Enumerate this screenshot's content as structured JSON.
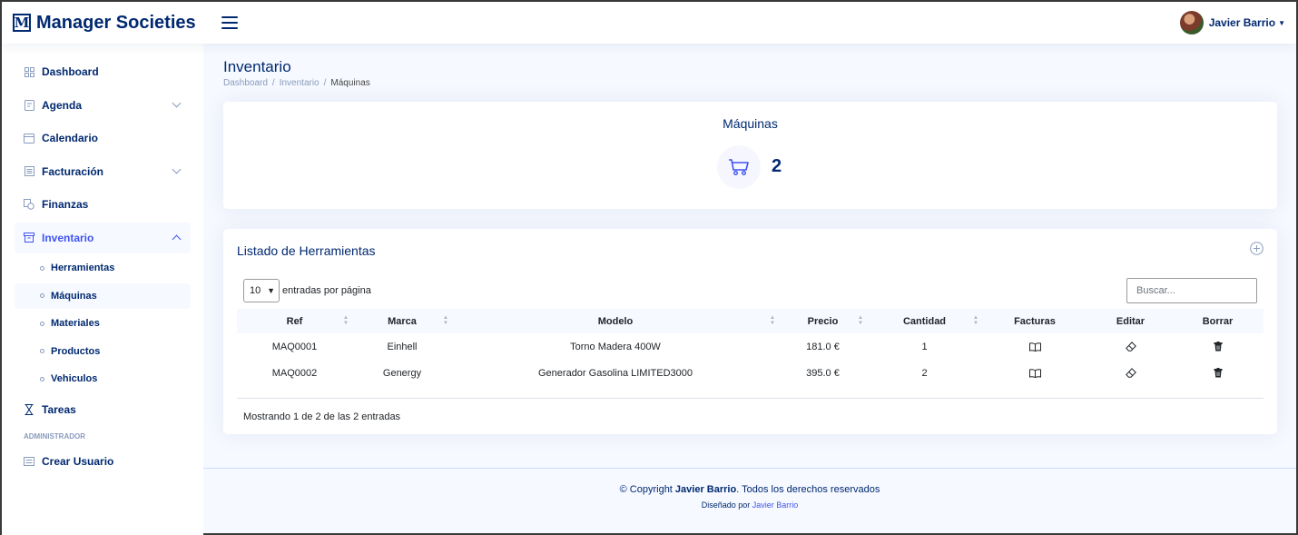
{
  "header": {
    "logo_letter": "M",
    "app_title": "Manager Societies",
    "user_name": "Javier Barrio"
  },
  "sidebar": {
    "items": [
      {
        "label": "Dashboard",
        "icon": "grid-icon"
      },
      {
        "label": "Agenda",
        "icon": "journal-icon"
      },
      {
        "label": "Calendario",
        "icon": "calendar-icon"
      },
      {
        "label": "Facturación",
        "icon": "invoice-icon"
      },
      {
        "label": "Finanzas",
        "icon": "cash-icon"
      },
      {
        "label": "Inventario",
        "icon": "archive-icon"
      }
    ],
    "sub_items": [
      "Herramientas",
      "Máquinas",
      "Materiales",
      "Productos",
      "Vehiculos"
    ],
    "tareas": "Tareas",
    "admin_heading": "ADMINISTRADOR",
    "crear_usuario": "Crear Usuario"
  },
  "page": {
    "title": "Inventario",
    "breadcrumb": [
      "Dashboard",
      "Inventario",
      "Máquinas"
    ]
  },
  "summary": {
    "title": "Máquinas",
    "value": "2",
    "icon": "cart-icon"
  },
  "list": {
    "title": "Listado de Herramientas",
    "per_page_value": "10",
    "per_page_label": "entradas por página",
    "search_placeholder": "Buscar...",
    "columns": [
      "Ref",
      "Marca",
      "Modelo",
      "Precio",
      "Cantidad",
      "Facturas",
      "Editar",
      "Borrar"
    ],
    "rows": [
      {
        "ref": "MAQ0001",
        "marca": "Einhell",
        "modelo": "Torno Madera 400W",
        "precio": "181.0 €",
        "cantidad": "1"
      },
      {
        "ref": "MAQ0002",
        "marca": "Genergy",
        "modelo": "Generador Gasolina LIMITED3000",
        "precio": "395.0 €",
        "cantidad": "2"
      }
    ],
    "info": "Mostrando 1 de 2 de las 2 entradas"
  },
  "footer": {
    "copy_prefix": "© Copyright ",
    "copy_name": "Javier Barrio",
    "copy_suffix": ". Todos los derechos reservados",
    "designed_by": "Diseñado por ",
    "designer": "Javier Barrio"
  },
  "colors": {
    "brand": "#012970",
    "accent": "#4154f1",
    "background": "#f6f9ff"
  }
}
